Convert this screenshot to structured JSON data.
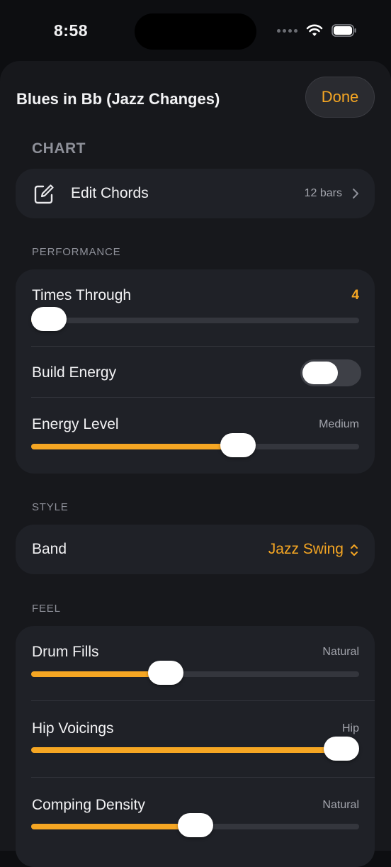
{
  "status": {
    "time": "8:58"
  },
  "sheet": {
    "title": "Blues in Bb (Jazz Changes)",
    "done_label": "Done"
  },
  "chart_section": {
    "header": "CHART",
    "edit_chords": {
      "label": "Edit Chords",
      "value": "12 bars"
    }
  },
  "performance": {
    "header": "PERFORMANCE",
    "times_through": {
      "label": "Times Through",
      "value": "4",
      "fraction": 0.05
    },
    "build_energy": {
      "label": "Build Energy",
      "on": false
    },
    "energy_level": {
      "label": "Energy Level",
      "value": "Medium",
      "fraction": 0.63
    }
  },
  "style": {
    "header": "STYLE",
    "band": {
      "label": "Band",
      "value": "Jazz Swing"
    }
  },
  "feel": {
    "header": "FEEL",
    "drum_fills": {
      "label": "Drum Fills",
      "value": "Natural",
      "fraction": 0.41
    },
    "hip_voicings": {
      "label": "Hip Voicings",
      "value": "Hip",
      "fraction": 0.97
    },
    "comping_density": {
      "label": "Comping Density",
      "value": "Natural",
      "fraction": 0.5
    }
  },
  "colors": {
    "accent": "#f5a623",
    "card": "#1f2127",
    "sheet": "#17181c"
  }
}
